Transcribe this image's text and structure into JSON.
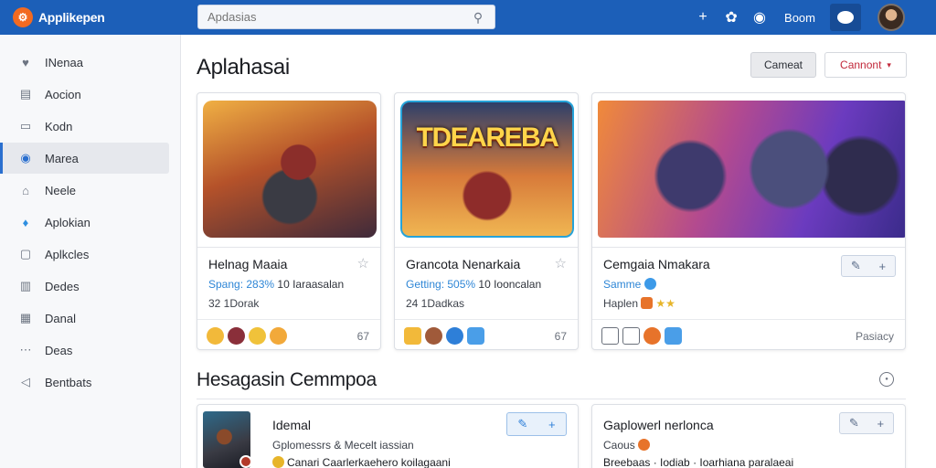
{
  "app": {
    "title": "Applikepen",
    "logo_mark": "⚙"
  },
  "search": {
    "placeholder": "Apdasias"
  },
  "topbar": {
    "boom_label": "Boom",
    "icons": [
      "plus-icon",
      "puzzle-icon",
      "help-icon",
      "chat-icon",
      "user-avatar"
    ]
  },
  "sidebar": {
    "items": [
      {
        "label": "INenaa",
        "icon": "heart-icon",
        "glyph": "♥"
      },
      {
        "label": "Aocion",
        "icon": "list-icon",
        "glyph": "▤"
      },
      {
        "label": "Kodn",
        "icon": "code-icon",
        "glyph": "▭"
      },
      {
        "label": "Marea",
        "icon": "at-icon",
        "glyph": "◉",
        "active": true
      },
      {
        "label": "Neele",
        "icon": "house-icon",
        "glyph": "⌂"
      },
      {
        "label": "Aplokian",
        "icon": "bird-icon",
        "glyph": "♦"
      },
      {
        "label": "Aplkcles",
        "icon": "chat-bubble-icon",
        "glyph": "▢"
      },
      {
        "label": "Dedes",
        "icon": "chart-icon",
        "glyph": "▥"
      },
      {
        "label": "Danal",
        "icon": "grid-icon",
        "glyph": "▦"
      },
      {
        "label": "Deas",
        "icon": "dots-icon",
        "glyph": "⋯"
      },
      {
        "label": "Bentbats",
        "icon": "sound-icon",
        "glyph": "◁"
      }
    ]
  },
  "main": {
    "title": "Aplahasai",
    "button_secondary": "Cameat",
    "button_primary": "Cannont",
    "cards": [
      {
        "title": "Helnag Maaia",
        "sub_highlight": "Spang: 283%",
        "sub_rest": " 10 Iaraasalan",
        "meta": "32 1Dorak",
        "count": "67"
      },
      {
        "title": "Grancota Nenarkaia",
        "thumb_title": "TDEAREBA",
        "sub_highlight": "Getting: 505%",
        "sub_rest": " 10 Iooncalan",
        "meta": "24 1Dadkas",
        "count": "67"
      },
      {
        "title": "Cemgaia Nmakara",
        "sub_highlight": "Samme",
        "meta": "Haplen",
        "foot_label": "Pasiacy"
      }
    ],
    "section_title": "Hesagasin Cemmpoa",
    "list_cards": [
      {
        "title": "Idemal",
        "sub": "Gplomessrs & Mecelt iassian",
        "meta": "Canari Caarlerkaehero koilagaani"
      },
      {
        "title": "Gaplowerl nerlonca",
        "sub": "Caous",
        "meta": "Breebaas · Iodiab · Ioarhiana paralaeai"
      }
    ]
  },
  "colors": {
    "topbar": "#1c5fb8",
    "accent": "#2a6fcf",
    "danger": "#c2283a",
    "highlight": "#2e86d6"
  }
}
